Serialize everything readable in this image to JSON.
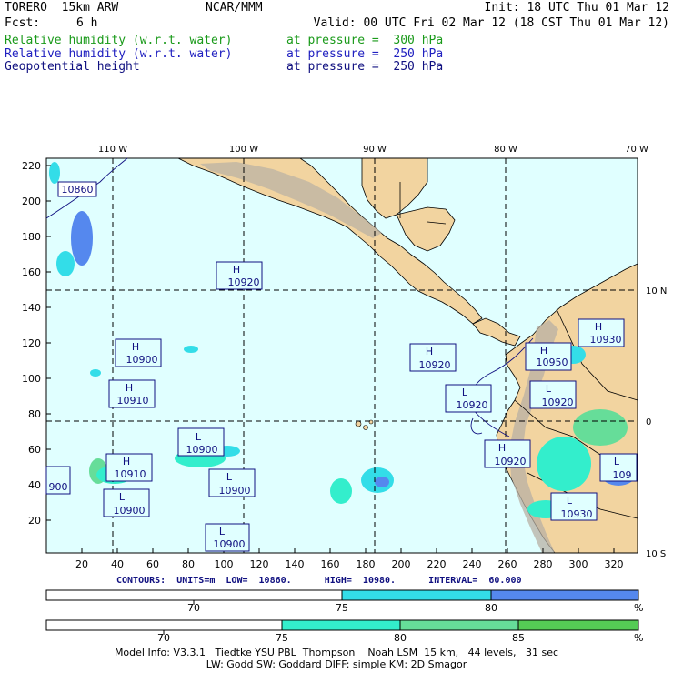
{
  "header": {
    "model": "TORERO  15km ARW",
    "org": "NCAR/MMM",
    "init": "Init: 18 UTC Thu 01 Mar 12",
    "fcst_label": "Fcst:",
    "fcst_value": "6 h",
    "valid": "Valid: 00 UTC Fri 02 Mar 12 (18 CST Thu 01 Mar 12)",
    "fields": [
      {
        "name": "Relative humidity (w.r.t. water)",
        "level": "at pressure =  300 hPa",
        "color": "#1a9a1a"
      },
      {
        "name": "Relative humidity (w.r.t. water)",
        "level": "at pressure =  250 hPa",
        "color": "#2020c0"
      },
      {
        "name": "Geopotential height",
        "level": "at pressure =  250 hPa",
        "color": "#101080"
      }
    ]
  },
  "map": {
    "lon_labels_top": [
      "110 W",
      "100 W",
      "90 W",
      "80 W",
      "70 W"
    ],
    "lat_labels_right": [
      "10 N",
      "0",
      "10 S"
    ],
    "y_ticks": [
      "220",
      "200",
      "180",
      "160",
      "140",
      "120",
      "100",
      "80",
      "60",
      "40",
      "20"
    ],
    "x_ticks": [
      "20",
      "40",
      "60",
      "80",
      "100",
      "120",
      "140",
      "160",
      "180",
      "200",
      "220",
      "240",
      "260",
      "280",
      "300",
      "320"
    ],
    "centers": [
      {
        "type": "",
        "value": "10860"
      },
      {
        "type": "H",
        "value": "10920"
      },
      {
        "type": "H",
        "value": "10900"
      },
      {
        "type": "H",
        "value": "10910"
      },
      {
        "type": "L",
        "value": "10900"
      },
      {
        "type": "H",
        "value": "10910"
      },
      {
        "type": "L",
        "value": "10900"
      },
      {
        "type": "L",
        "value": "10900"
      },
      {
        "type": "L",
        "value": "10900"
      },
      {
        "type": "",
        "value": "900"
      },
      {
        "type": "H",
        "value": "10920"
      },
      {
        "type": "L",
        "value": "10920"
      },
      {
        "type": "H",
        "value": "10950"
      },
      {
        "type": "H",
        "value": "10930"
      },
      {
        "type": "L",
        "value": "10920"
      },
      {
        "type": "H",
        "value": "10920"
      },
      {
        "type": "L",
        "value": "10930"
      },
      {
        "type": "L",
        "value": "109"
      }
    ],
    "colors": {
      "ocean": "#e0ffff",
      "land": "#f2d4a0",
      "grid": "#000000",
      "label_box": "#101080"
    }
  },
  "contours": "CONTOURS:  UNITS=m  LOW=  10860.      HIGH=  10980.      INTERVAL=  60.000",
  "colorbar1": {
    "labels": [
      "70",
      "75",
      "80",
      "%"
    ],
    "colors": [
      "#ffffff",
      "#33dde8",
      "#5588ee"
    ]
  },
  "colorbar2": {
    "labels": [
      "70",
      "75",
      "80",
      "85",
      "%"
    ],
    "colors": [
      "#ffffff",
      "#33eecc",
      "#66dd99",
      "#55cc55"
    ]
  },
  "footer": {
    "line1": "Model Info: V3.3.1   Tiedtke YSU PBL  Thompson    Noah LSM  15 km,   44 levels,   31 sec",
    "line2": "LW: Godd SW: Goddard DIFF: simple KM: 2D Smagor"
  }
}
